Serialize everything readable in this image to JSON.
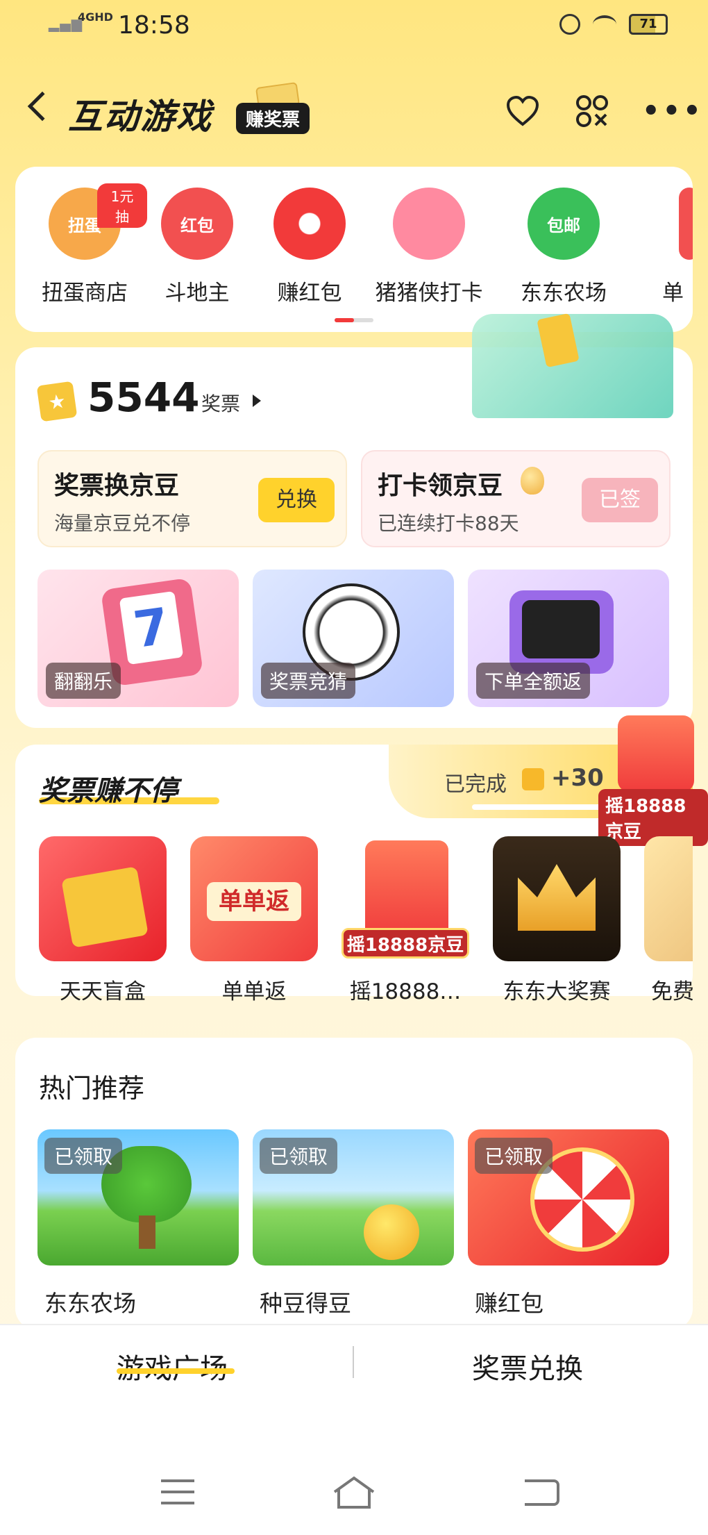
{
  "status_bar": {
    "network": "4GHD",
    "time": "18:58",
    "battery": "71"
  },
  "header": {
    "title": "互动游戏",
    "earn_badge": "赚奖票"
  },
  "games": [
    {
      "label": "扭蛋商店",
      "icon_text": "扭蛋",
      "badge": "1元抽",
      "color": "#f7a84a"
    },
    {
      "label": "斗地主",
      "icon_text": "红包",
      "color": "#f25050"
    },
    {
      "label": "赚红包",
      "icon_text": "",
      "color": "#f23a3a"
    },
    {
      "label": "猪猪侠打卡",
      "icon_text": "",
      "color": "#ff8aa0"
    },
    {
      "label": "东东农场",
      "icon_text": "包邮",
      "color": "#3ac05a"
    },
    {
      "label": "单",
      "icon_text": "",
      "color": "#f25050"
    }
  ],
  "tickets": {
    "count": "5544",
    "unit": "奖票"
  },
  "exchange": {
    "title": "奖票换京豆",
    "desc": "海量京豆兑不停",
    "button": "兑换"
  },
  "checkin": {
    "title": "打卡领京豆",
    "desc": "已连续打卡88天",
    "button": "已签"
  },
  "promos": [
    {
      "label": "翻翻乐"
    },
    {
      "label": "奖票竞猜"
    },
    {
      "label": "下单全额返"
    }
  ],
  "earn": {
    "title": "奖票赚不停",
    "done_label": "已完成",
    "done_value": "+30",
    "float_tag": "摇18888京豆",
    "tasks": [
      {
        "label": "天天盲盒"
      },
      {
        "label": "单单返",
        "img_text": "单单返"
      },
      {
        "label": "摇18888…",
        "img_text": "摇18888京豆"
      },
      {
        "label": "东东大奖赛"
      },
      {
        "label": "免费"
      }
    ]
  },
  "hot": {
    "title": "热门推荐",
    "items": [
      {
        "label": "东东农场",
        "status": "已领取"
      },
      {
        "label": "种豆得豆",
        "status": "已领取"
      },
      {
        "label": "赚红包",
        "status": "已领取"
      }
    ]
  },
  "tabs": {
    "plaza": "游戏广场",
    "exchange": "奖票兑换"
  },
  "icons": {
    "back": "chevron-left-icon",
    "favorite": "heart-icon",
    "scan": "scan-icon",
    "more": "more-icon",
    "ticket": "ticket-icon"
  },
  "colors": {
    "accent_yellow": "#ffd22c",
    "accent_red": "#f23a3a",
    "background_top": "#ffe680"
  }
}
